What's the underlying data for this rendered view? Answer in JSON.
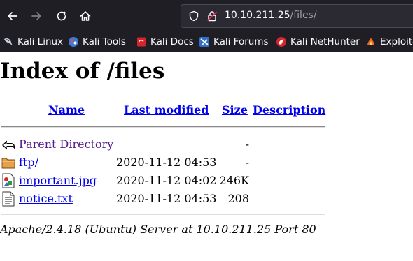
{
  "browser": {
    "url_host": "10.10.211.25",
    "url_path": "/files/",
    "bookmarks": [
      {
        "label": "Kali Linux",
        "icon": "kali-dragon-icon"
      },
      {
        "label": "Kali Tools",
        "icon": "kali-tools-icon"
      },
      {
        "label": "Kali Docs",
        "icon": "kali-docs-icon"
      },
      {
        "label": "Kali Forums",
        "icon": "kali-forums-icon"
      },
      {
        "label": "Kali NetHunter",
        "icon": "kali-nethunter-icon"
      },
      {
        "label": "Exploit-",
        "icon": "exploit-db-icon"
      }
    ],
    "colors": {
      "chrome_bg": "#1f1e25",
      "urlbar_bg": "#2b2a33",
      "chrome_text": "#fbfbfe"
    }
  },
  "page": {
    "title": "Index of /files",
    "columns": {
      "name": "Name",
      "last_modified": "Last modified",
      "size": "Size",
      "description": "Description"
    },
    "entries": [
      {
        "name": "Parent Directory",
        "modified": "",
        "size": "-",
        "icon": "back-arrow-icon",
        "visited": true
      },
      {
        "name": "ftp/",
        "modified": "2020-11-12 04:53",
        "size": "-",
        "icon": "folder-icon",
        "visited": false
      },
      {
        "name": "important.jpg",
        "modified": "2020-11-12 04:02",
        "size": "246K",
        "icon": "image-file-icon",
        "visited": false
      },
      {
        "name": "notice.txt",
        "modified": "2020-11-12 04:53",
        "size": "208",
        "icon": "text-file-icon",
        "visited": false
      }
    ],
    "footer": "Apache/2.4.18 (Ubuntu) Server at 10.10.211.25 Port 80",
    "colors": {
      "link": "#0000ee",
      "visited_link": "#551a8b"
    }
  }
}
